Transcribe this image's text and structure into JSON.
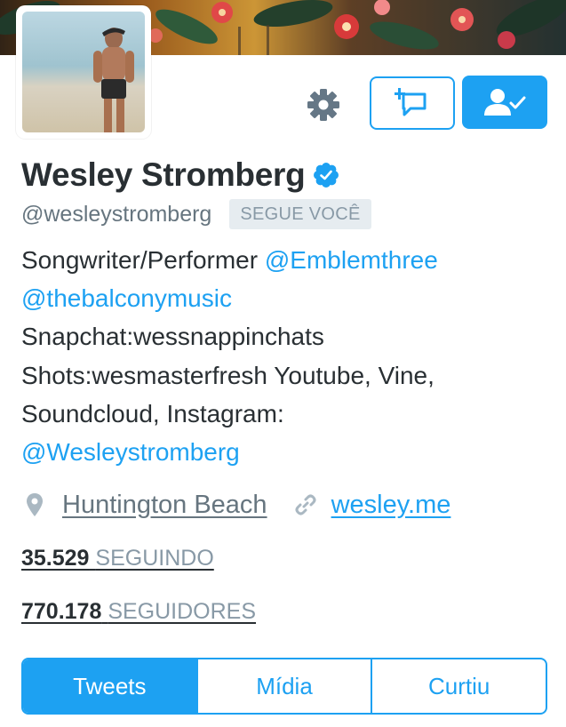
{
  "profile": {
    "name": "Wesley Stromberg",
    "handle": "@wesleystromberg",
    "follows_you_badge": "SEGUE VOCÊ",
    "verified": true
  },
  "header_actions": {
    "settings_icon": "gear-icon",
    "message_icon": "add-message-icon",
    "following_icon": "person-check-icon"
  },
  "bio": {
    "line1_text": "Songwriter/Performer ",
    "line1_mention": "@Emblemthree",
    "line2_mention": "@thebalconymusic",
    "line3": "Snapchat:wessnappinchats",
    "line4": "Shots:wesmasterfresh Youtube, Vine,",
    "line5": "Soundcloud, Instagram:",
    "line6_mention": "@Wesleystromberg"
  },
  "meta": {
    "location": "Huntington Beach",
    "location_icon": "location-pin-icon",
    "website": "wesley.me",
    "website_icon": "link-icon"
  },
  "stats": {
    "following_count": "35.529",
    "following_label": "SEGUINDO",
    "followers_count": "770.178",
    "followers_label": "SEGUIDORES"
  },
  "tabs": [
    {
      "label": "Tweets",
      "active": true
    },
    {
      "label": "Mídia",
      "active": false
    },
    {
      "label": "Curtiu",
      "active": false
    }
  ],
  "colors": {
    "accent": "#1da1f2",
    "text_primary": "#292f33",
    "text_secondary": "#66757f",
    "badge_bg": "#e6ecf0",
    "badge_text": "#8899a6",
    "icon_gray": "#657786"
  }
}
